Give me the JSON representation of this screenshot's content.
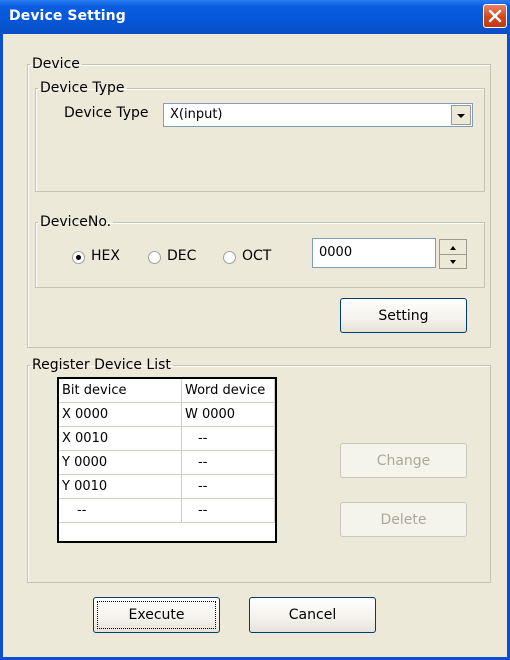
{
  "window": {
    "title": "Device Setting"
  },
  "device_group": {
    "legend": "Device",
    "device_type_group": {
      "legend": "Device Type",
      "label": "Device Type",
      "selected": "X(input)"
    },
    "device_no_group": {
      "legend": "DeviceNo.",
      "radios": [
        {
          "label": "HEX",
          "selected": true
        },
        {
          "label": "DEC",
          "selected": false
        },
        {
          "label": "OCT",
          "selected": false
        }
      ],
      "value": "0000"
    },
    "setting_label": "Setting"
  },
  "register_group": {
    "legend": "Register Device List",
    "columns": [
      "Bit device",
      "Word device"
    ],
    "rows": [
      [
        "X 0000",
        "W 0000"
      ],
      [
        "X 0010",
        "--"
      ],
      [
        "Y 0000",
        "--"
      ],
      [
        "Y 0010",
        "--"
      ],
      [
        "--",
        "--"
      ]
    ],
    "change_label": "Change",
    "delete_label": "Delete"
  },
  "footer": {
    "execute_label": "Execute",
    "cancel_label": "Cancel"
  }
}
